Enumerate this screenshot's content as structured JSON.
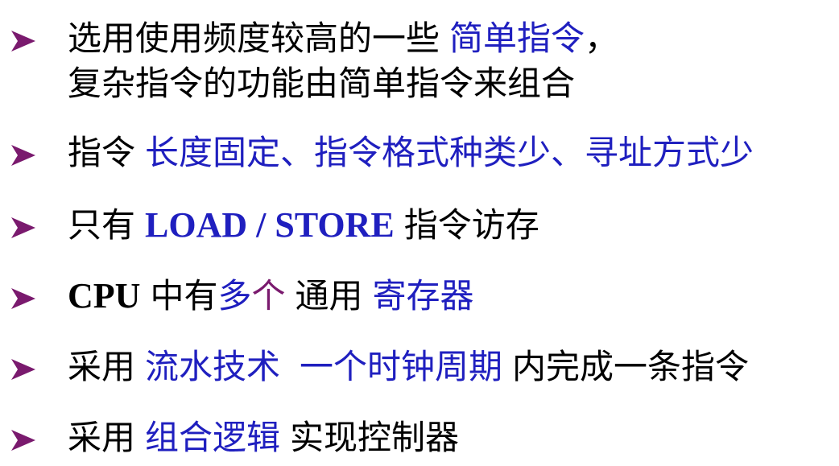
{
  "colors": {
    "text": "#000000",
    "highlight": "#1f1fbf",
    "bullet": "#7a1a6e"
  },
  "bullet_icon": "arrowhead-bullet-icon",
  "items": [
    {
      "line1": {
        "a": "选用使用频度较高的一些",
        "b": "简单指令",
        "c": "，"
      },
      "line2": "复杂指令的功能由简单指令来组合"
    },
    {
      "a": "指令",
      "b": "长度固定、指令格式种类少、寻址方式少"
    },
    {
      "a": "只有",
      "b": "LOAD / STORE",
      "c": "指令访存"
    },
    {
      "a": "CPU",
      "b": "中有",
      "c": "多",
      "d": "个",
      "e": "通用",
      "f": "寄存器"
    },
    {
      "a": "采用",
      "b": "流水技术",
      "c": "一个时钟周期",
      "d": "内完成一条指令"
    },
    {
      "a": "采用",
      "b": "组合逻辑",
      "c": "实现控制器"
    }
  ]
}
